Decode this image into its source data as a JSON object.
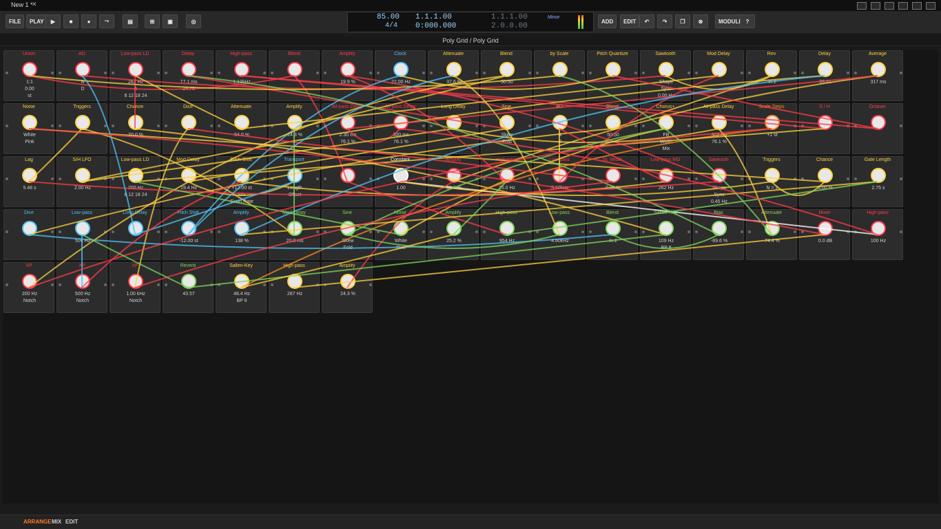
{
  "window": {
    "doc_tab": "New 1 *"
  },
  "toolbar": {
    "file": "FILE",
    "play": "PLAY",
    "add": "ADD",
    "edit": "EDIT",
    "module": "MODULE",
    "icons": [
      "play-icon",
      "stop-icon",
      "record-icon",
      "automation-icon",
      "layout-icon",
      "split-icon",
      "panel-icon",
      "metronome-icon",
      "undo-icon",
      "redo-icon",
      "copy-icon",
      "cancel-icon",
      "help-icon"
    ]
  },
  "transport": {
    "tempo": "85.00",
    "signature": "4/4",
    "position_bars": "1.1.1.00",
    "position_time": "0:000.000",
    "loop_start": "1.1.1.00",
    "loop_end": "2.0.0.00",
    "key": "Minor"
  },
  "panel": {
    "title": "Poly Grid / Poly Grid"
  },
  "modules": [
    {
      "name": "Union",
      "color": "#ff3b4a",
      "v1": "1:1",
      "v2": "0.00",
      "v3": "st"
    },
    {
      "name": "AD",
      "color": "#ff3b4a",
      "v1": "A",
      "v2": "D"
    },
    {
      "name": "Low-pass LD",
      "color": "#ff3b4a",
      "v1": "262 Hz",
      "v2": "A",
      "v3": "6 12 18 24"
    },
    {
      "name": "Delay",
      "color": "#ff3b4a",
      "v1": "77.1 ms",
      "v2": "24.76"
    },
    {
      "name": "High-pass",
      "color": "#ff3b4a",
      "v1": "1.12kHz"
    },
    {
      "name": "Blend",
      "color": "#ff3b4a"
    },
    {
      "name": "Amplify",
      "color": "#ff3b4a",
      "v1": "19.9 %"
    },
    {
      "name": "Clock",
      "color": "#4fc3f7",
      "v1": "22.00 Hz"
    },
    {
      "name": "Attenuate",
      "color": "#ffd23f",
      "v1": "37.6 %"
    },
    {
      "name": "Blend",
      "color": "#ffd23f",
      "v1": "50:50"
    },
    {
      "name": "by Scale",
      "color": "#ffd23f"
    },
    {
      "name": "Pitch Quantize",
      "color": "#ffd23f"
    },
    {
      "name": "Sawtooth",
      "color": "#ffd23f",
      "v1": "Shape",
      "v2": "Sync",
      "v3": "0.00 Hz"
    },
    {
      "name": "Mod Delay",
      "color": "#ffd23f"
    },
    {
      "name": "Rev",
      "color": "#ffd23f",
      "v1": "In 2"
    },
    {
      "name": "Delay",
      "color": "#ffd23f",
      "v1": "39.61"
    },
    {
      "name": "Average",
      "color": "#ffd23f",
      "v1": "317 ms"
    },
    {
      "name": "Noise",
      "color": "#ffd23f",
      "v1": "White",
      "v2": "Pink"
    },
    {
      "name": "Triggers",
      "color": "#ffd23f"
    },
    {
      "name": "Chance",
      "color": "#ffd23f",
      "v1": "20.0 %"
    },
    {
      "name": "Dice",
      "color": "#ffd23f"
    },
    {
      "name": "Attenuate",
      "color": "#ffd23f",
      "v1": "54.0 %"
    },
    {
      "name": "Amplify",
      "color": "#ffd23f",
      "v1": "24.3 %"
    },
    {
      "name": "All-pass Delay",
      "color": "#ff3b4a",
      "v1": "2.30 ms",
      "v2": "76.1 %"
    },
    {
      "name": "All-pass Delay",
      "color": "#ff3b4a",
      "v1": "300 ms",
      "v2": "76.1 %"
    },
    {
      "name": "Long Delay",
      "color": "#ffd23f"
    },
    {
      "name": "Sine",
      "color": "#ffd23f",
      "v1": "Skew",
      "v2": "Fold"
    },
    {
      "name": "AD",
      "color": "#ffd23f",
      "v1": "A",
      "v2": "D"
    },
    {
      "name": "Blend",
      "color": "#ffd23f",
      "v1": "50:50"
    },
    {
      "name": "Chorus+",
      "color": "#ffd23f",
      "v1": "FB",
      "v2": "Width",
      "v3": "Mix"
    },
    {
      "name": "All-pass Delay",
      "color": "#ffd23f",
      "v1": "303 ms",
      "v2": "76.1 %"
    },
    {
      "name": "Scale Steps",
      "color": "#ff8a1f",
      "v1": "+1 st"
    },
    {
      "name": "S / H",
      "color": "#ff3b4a"
    },
    {
      "name": "Octaver",
      "color": "#ff3b4a"
    },
    {
      "name": "Lag",
      "color": "#ffd23f",
      "v1": "5.48 s"
    },
    {
      "name": "S/H LFO",
      "color": "#ffd23f",
      "v1": "2.00 Hz"
    },
    {
      "name": "Low-pass LD",
      "color": "#ffd23f",
      "v1": "200 Hz",
      "v2": "6 12 18 24"
    },
    {
      "name": "Mod Delay",
      "color": "#ffd23f",
      "v1": "19.4 Hz"
    },
    {
      "name": "Pitch Shift",
      "color": "#ffd23f",
      "v1": "+12.00 st",
      "v2": "Mix",
      "v3": "Grain Rate"
    },
    {
      "name": "Transport",
      "color": "#4fc3f7",
      "v1": "Length",
      "v2": "Offset"
    },
    {
      "name": "Invert",
      "color": "#ff3b4a"
    },
    {
      "name": "Constant",
      "color": "#ffffff",
      "v1": "1.00"
    },
    {
      "name": "Amplify",
      "color": "#ff3b4a",
      "v1": "50.0 %"
    },
    {
      "name": "High-pass",
      "color": "#ff3b4a",
      "v1": "25.0 Hz"
    },
    {
      "name": "Low-pass",
      "color": "#ff3b4a",
      "v1": "5.10kHz"
    },
    {
      "name": "St. Width",
      "color": "#ff3b4a",
      "v1": "0.00 %"
    },
    {
      "name": "Low-pass MG",
      "color": "#ff3b4a",
      "v1": "262 Hz"
    },
    {
      "name": "Sawtooth",
      "color": "#ff3b4a",
      "v1": "Shape",
      "v2": "Sync",
      "v3": "0.45 Hz"
    },
    {
      "name": "Triggers",
      "color": "#ffd23f",
      "v1": "N = 2"
    },
    {
      "name": "Chance",
      "color": "#ffd23f",
      "v1": "5.00 %"
    },
    {
      "name": "Gate Length",
      "color": "#ffd23f",
      "v1": "2.75 s"
    },
    {
      "name": "Dice",
      "color": "#4fc3f7"
    },
    {
      "name": "Low-pass",
      "color": "#4fc3f7",
      "v1": "506 Hz"
    },
    {
      "name": "Long Delay",
      "color": "#4fc3f7"
    },
    {
      "name": "Pitch Shift",
      "color": "#4fc3f7",
      "v1": "-12.00 st"
    },
    {
      "name": "Amplify",
      "color": "#4fc3f7",
      "v1": "138 %"
    },
    {
      "name": "Mod Delay",
      "color": "#7fd65b",
      "v1": "20.0 ms"
    },
    {
      "name": "Sine",
      "color": "#7fd65b",
      "v1": "Skew",
      "v2": "Fold"
    },
    {
      "name": "Noise",
      "color": "#7fd65b",
      "v1": "White",
      "v2": "Pink"
    },
    {
      "name": "Amplify",
      "color": "#7fd65b",
      "v1": "25.2 %"
    },
    {
      "name": "High-pass",
      "color": "#7fd65b",
      "v1": "954 Hz"
    },
    {
      "name": "Low-pass",
      "color": "#7fd65b",
      "v1": "4.60kHz"
    },
    {
      "name": "Blend",
      "color": "#7fd65b",
      "v1": "In 2"
    },
    {
      "name": "Sallen-Key",
      "color": "#7fd65b",
      "v1": "109 Hz",
      "v2": "BP 8"
    },
    {
      "name": "Bias",
      "color": "#7fd65b",
      "v1": "-89.6 %"
    },
    {
      "name": "Attenuate",
      "color": "#7fd65b",
      "v1": "74.4 %"
    },
    {
      "name": "Mixer",
      "color": "#ff3b4a",
      "v1": "0.0 dB"
    },
    {
      "name": "High-pass",
      "color": "#ff3b4a",
      "v1": "100 Hz"
    },
    {
      "name": "XP",
      "color": "#ff3b4a",
      "v1": "200 Hz",
      "v2": "Notch"
    },
    {
      "name": "XP",
      "color": "#ff3b4a",
      "v1": "500 Hz",
      "v2": "Notch"
    },
    {
      "name": "XP",
      "color": "#ff3b4a",
      "v1": "1.00 kHz",
      "v2": "Notch"
    },
    {
      "name": "Reverb",
      "color": "#7fd65b",
      "v1": "43.57"
    },
    {
      "name": "Sallen-Key",
      "color": "#ffd23f",
      "v1": "48.4 Hz",
      "v2": "BP 6"
    },
    {
      "name": "High-pass",
      "color": "#ffd23f",
      "v1": "287 Hz"
    },
    {
      "name": "Amplify",
      "color": "#ffd23f",
      "v1": "24.3 %"
    }
  ],
  "bottom": {
    "tabs": [
      "ARRANGE",
      "MIX",
      "EDIT"
    ],
    "active_tab": "ARRANGE"
  },
  "colors": {
    "red": "#ff3b4a",
    "yellow": "#ffd23f",
    "orange": "#ff8a1f",
    "blue": "#4fc3f7",
    "green": "#7fd65b",
    "background": "#151515"
  }
}
